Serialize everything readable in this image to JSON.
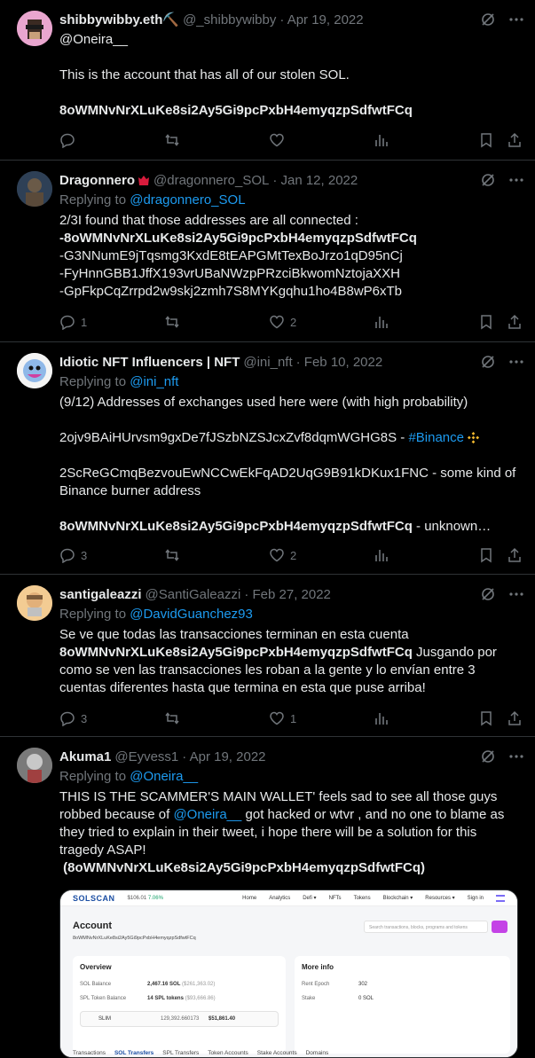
{
  "tweets": [
    {
      "name": "shibbywibby.eth⛏️",
      "handle": "@_shibbywibby",
      "date": "· Apr 19, 2022",
      "reply_to": "@Oneira__",
      "text1": "This is the account that has all of our stolen SOL.",
      "address": "8oWMNvNrXLuKe8si2Ay5Gi9pcPxbH4emyqzpSdfwtFCq",
      "replies": "",
      "retweets": "",
      "likes": ""
    },
    {
      "name": "Dragonnero",
      "handle": "@dragonnero_SOL",
      "date": "· Jan 12, 2022",
      "replying_label": "Replying to",
      "reply_to": "@dragonnero_SOL",
      "text1": "2/3I found that those addresses are all connected :",
      "address": "-8oWMNvNrXLuKe8si2Ay5Gi9pcPxbH4emyqzpSdfwtFCq",
      "line2": "-G3NNumE9jTqsmg3KxdE8tEAPGMtTexBoJrzo1qD95nCj",
      "line3": "-FyHnnGBB1JffX193vrUBaNWzpPRzciBkwomNztojaXXH",
      "line4": "-GpFkpCqZrrpd2w9skj2zmh7S8MYKgqhu1ho4B8wP6xTb",
      "replies": "1",
      "retweets": "",
      "likes": "2"
    },
    {
      "name": "Idiotic NFT Influencers | NFT",
      "handle": "@ini_nft",
      "date": "· Feb 10, 2022",
      "replying_label": "Replying to",
      "reply_to": "@ini_nft",
      "text1": "(9/12) Addresses of exchanges used here were (with high probability)",
      "line2a": "2ojv9BAiHUrvsm9gxDe7fJSzbNZSJcxZvf8dqmWGHG8S - ",
      "hashtag": "#Binance",
      "line3": "2ScReGCmqBezvouEwNCCwEkFqAD2UqG9B91kDKux1FNC - some kind of Binance burner address",
      "address": "8oWMNvNrXLuKe8si2Ay5Gi9pcPxbH4emyqzpSdfwtFCq",
      "tail": " - unknown…",
      "replies": "3",
      "retweets": "",
      "likes": "2"
    },
    {
      "name": "santigaleazzi",
      "handle": "@SantiGaleazzi",
      "date": "· Feb 27, 2022",
      "replying_label": "Replying to",
      "reply_to": "@DavidGuanchez93",
      "text1": "Se ve que todas las transacciones terminan en esta cuenta",
      "address": "8oWMNvNrXLuKe8si2Ay5Gi9pcPxbH4emyqzpSdfwtFCq",
      "tail": " Jusgando por como se ven las transacciones les roban a la gente y lo envían entre 3 cuentas diferentes hasta que termina en esta que puse arriba!",
      "replies": "3",
      "retweets": "",
      "likes": "1"
    },
    {
      "name": "Akuma1",
      "handle": "@Eyvess1",
      "date": "· Apr 19, 2022",
      "replying_label": "Replying to",
      "reply_to": "@Oneira__",
      "text1": "THIS IS THE SCAMMER'S MAIN WALLET' feels sad to see all those guys robbed because of ",
      "mention": "@Oneira__",
      "text2": " got hacked or wtvr , and no one to blame as they tried to explain in their tweet, i hope there will be a solution for this tragedy ASAP!",
      "address": " (8oWMNvNrXLuKe8si2Ay5Gi9pcPxbH4emyqzpSdfwtFCq)"
    }
  ],
  "solscan": {
    "logo": "SOLSCAN",
    "price": "$106.01",
    "change": "7.06%",
    "nav": [
      "Home",
      "Analytics",
      "Defi ▾",
      "NFTs",
      "Tokens",
      "Blockchain ▾",
      "Resources ▾",
      "Sign in"
    ],
    "search_placeholder": "Search transactions, blocks, programs and tokens",
    "account_title": "Account",
    "account_addr": "8oWMNvNrXLuKe8si2Ay5Gi9pcPxbH4emyqzpSdfwtFCq",
    "overview_title": "Overview",
    "sol_balance_label": "SOL Balance",
    "sol_balance_value": "2,467.16 SOL",
    "sol_balance_usd": "($261,363.02)",
    "token_balance_label": "SPL Token Balance",
    "token_balance_value": "14 SPL tokens",
    "token_balance_usd": "($93,666.86)",
    "token_name": "SLIM",
    "token_amount": "129,392.660173",
    "token_usd": "$51,861.40",
    "more_info_title": "More info",
    "rent_epoch_label": "Rent Epoch",
    "rent_epoch_value": "302",
    "stake_label": "Stake",
    "stake_value": "0 SOL",
    "tabs": [
      "Transactions",
      "SOL Transfers",
      "SPL Transfers",
      "Token Accounts",
      "Stake Accounts",
      "Domains"
    ]
  },
  "colors": {
    "accent": "#1d9bf0",
    "muted": "#71767b",
    "text": "#e7e9ea",
    "divider": "#2f3336"
  }
}
